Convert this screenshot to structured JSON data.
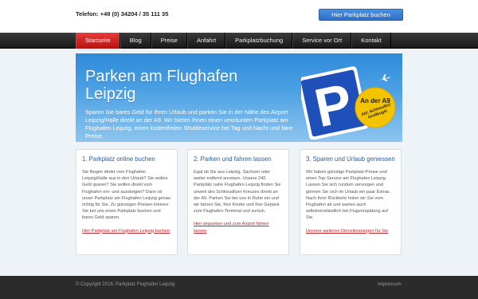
{
  "header": {
    "phone": "Telefon: +49 (0) 34204 / 35 111 35",
    "book_button": "Hier Parkplatz buchen"
  },
  "nav": {
    "items": [
      "Startseite",
      "Blog",
      "Preise",
      "Anfahrt",
      "Parkplatzbuchung",
      "Service vor Ort",
      "Kontakt"
    ],
    "active": "Startseite"
  },
  "hero": {
    "title": "Parken am Flughafen Leipzig",
    "text": "Sparen Sie bares Geld für Ihren Urlaub und parken Sie in der Nähe des Airport Leipzig/Halle direkt an der A9. Wir bieten Ihnen einen umzäunten Parkplatz am Flughafen Leipzig, einen kostenfreien Shuttleservice bei Tag und Nacht und faire Preise.",
    "sign_letter": "P",
    "badge_title": "An der A9",
    "badge_sub1": "Abf. Schkeuditz/",
    "badge_sub2": "Großkugel"
  },
  "columns": [
    {
      "title": "1. Parkplatz online buchen",
      "text": "Sie fliegen direkt vom Flughafen Leipzig/Halle aus in den Urlaub? Sie wollen Geld sparen? Sie wollen direkt vom Flughafen ein- und aussteigen? Dann ist unser Parkplatz am Flughafen Leipzig genau richtig für Sie. Zu günstigen Preisen können Sie bei uns einen Parkplatz buchen und bares Geld sparen.",
      "link": "Hier Parkplatz am Flughafen Leipzig buchen"
    },
    {
      "title": "2. Parken und fahren lassen",
      "text": "Egal ob Sie aus Leipzig, Sachsen oder weiter entfernt anreisen. Unsere 240 Parkplätz nahe Flughafen Leipzig finden Sie unweit des Schkeuditzer Kreuzes direkt an der A9. Parken Sie bei uns in Ruhe ein und wir fahren Sie, Ihre Kinder und Ihre Gepäck zum Flughafen-Terminal und zurück.",
      "link": "Hier einparken und zum Airport fahren lassen"
    },
    {
      "title": "3. Sparen und Urlaub geniessen",
      "text": "Wir haben günstige Parkplatz-Preise und einen Top-Service am Flughafen Leipzig. Lassen Sie sich rundum versorgen und gönnen Sie sich im Urlaub ein paar Extras. Nach Ihrer Rückkehr holen wir Sie vom Flughafen ab und warten auch selbstverständlich bei Flugverspätung auf Sie.",
      "link": "Unserer weiteren Dienstleistungen für Sie"
    }
  ],
  "footer": {
    "copyright": "© Copyright 2016. Parkplatz Flughafen Leipzig",
    "impressum": "Impressum"
  },
  "colors": {
    "nav_active": "#d42020",
    "accent_blue": "#2d6fc6",
    "hero_top": "#2f8ad8",
    "link_red": "#c0262b",
    "badge_yellow": "#f5c400"
  }
}
